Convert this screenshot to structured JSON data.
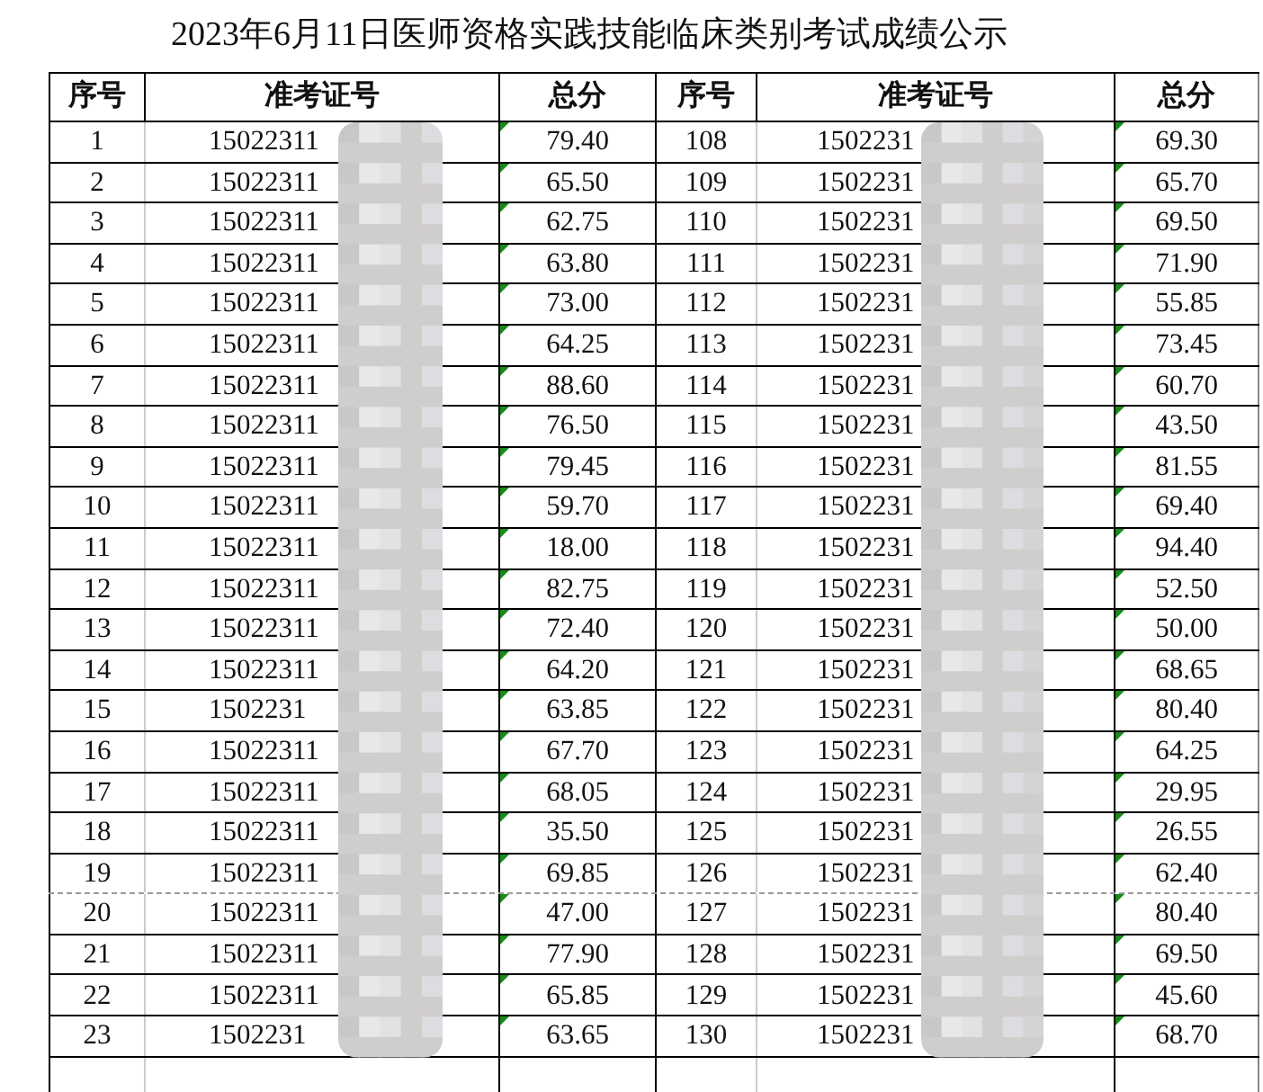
{
  "title": "2023年6月11日医师资格实践技能临床类别考试成绩公示",
  "columns": [
    "序号",
    "准考证号",
    "总分",
    "序号",
    "准考证号",
    "总分"
  ],
  "rows": [
    {
      "left": {
        "no": "1",
        "id": "15022311",
        "score": "79.40"
      },
      "right": {
        "no": "108",
        "id": "1502231",
        "score": "69.30"
      },
      "page_break": false
    },
    {
      "left": {
        "no": "2",
        "id": "15022311",
        "score": "65.50"
      },
      "right": {
        "no": "109",
        "id": "1502231",
        "score": "65.70"
      },
      "page_break": false
    },
    {
      "left": {
        "no": "3",
        "id": "15022311",
        "score": "62.75"
      },
      "right": {
        "no": "110",
        "id": "1502231",
        "score": "69.50"
      },
      "page_break": false
    },
    {
      "left": {
        "no": "4",
        "id": "15022311",
        "score": "63.80"
      },
      "right": {
        "no": "111",
        "id": "1502231",
        "score": "71.90"
      },
      "page_break": false
    },
    {
      "left": {
        "no": "5",
        "id": "15022311",
        "score": "73.00"
      },
      "right": {
        "no": "112",
        "id": "1502231",
        "score": "55.85"
      },
      "page_break": false
    },
    {
      "left": {
        "no": "6",
        "id": "15022311",
        "score": "64.25"
      },
      "right": {
        "no": "113",
        "id": "1502231",
        "score": "73.45"
      },
      "page_break": false
    },
    {
      "left": {
        "no": "7",
        "id": "15022311",
        "score": "88.60"
      },
      "right": {
        "no": "114",
        "id": "1502231",
        "score": "60.70"
      },
      "page_break": false
    },
    {
      "left": {
        "no": "8",
        "id": "15022311",
        "score": "76.50"
      },
      "right": {
        "no": "115",
        "id": "1502231",
        "score": "43.50"
      },
      "page_break": false
    },
    {
      "left": {
        "no": "9",
        "id": "15022311",
        "score": "79.45"
      },
      "right": {
        "no": "116",
        "id": "1502231",
        "score": "81.55"
      },
      "page_break": false
    },
    {
      "left": {
        "no": "10",
        "id": "15022311",
        "score": "59.70"
      },
      "right": {
        "no": "117",
        "id": "1502231",
        "score": "69.40"
      },
      "page_break": false
    },
    {
      "left": {
        "no": "11",
        "id": "15022311",
        "score": "18.00"
      },
      "right": {
        "no": "118",
        "id": "1502231",
        "score": "94.40"
      },
      "page_break": false
    },
    {
      "left": {
        "no": "12",
        "id": "15022311",
        "score": "82.75"
      },
      "right": {
        "no": "119",
        "id": "1502231",
        "score": "52.50"
      },
      "page_break": false
    },
    {
      "left": {
        "no": "13",
        "id": "15022311",
        "score": "72.40"
      },
      "right": {
        "no": "120",
        "id": "1502231",
        "score": "50.00"
      },
      "page_break": false
    },
    {
      "left": {
        "no": "14",
        "id": "15022311",
        "score": "64.20"
      },
      "right": {
        "no": "121",
        "id": "1502231",
        "score": "68.65"
      },
      "page_break": false
    },
    {
      "left": {
        "no": "15",
        "id": "1502231",
        "score": "63.85"
      },
      "right": {
        "no": "122",
        "id": "1502231",
        "score": "80.40"
      },
      "page_break": false
    },
    {
      "left": {
        "no": "16",
        "id": "15022311",
        "score": "67.70"
      },
      "right": {
        "no": "123",
        "id": "1502231",
        "score": "64.25"
      },
      "page_break": false
    },
    {
      "left": {
        "no": "17",
        "id": "15022311",
        "score": "68.05"
      },
      "right": {
        "no": "124",
        "id": "1502231",
        "score": "29.95"
      },
      "page_break": false
    },
    {
      "left": {
        "no": "18",
        "id": "15022311",
        "score": "35.50"
      },
      "right": {
        "no": "125",
        "id": "1502231",
        "score": "26.55"
      },
      "page_break": false
    },
    {
      "left": {
        "no": "19",
        "id": "15022311",
        "score": "69.85"
      },
      "right": {
        "no": "126",
        "id": "1502231",
        "score": "62.40"
      },
      "page_break": true
    },
    {
      "left": {
        "no": "20",
        "id": "15022311",
        "score": "47.00"
      },
      "right": {
        "no": "127",
        "id": "1502231",
        "score": "80.40"
      },
      "page_break": false
    },
    {
      "left": {
        "no": "21",
        "id": "15022311",
        "score": "77.90"
      },
      "right": {
        "no": "128",
        "id": "1502231",
        "score": "69.50"
      },
      "page_break": false
    },
    {
      "left": {
        "no": "22",
        "id": "15022311",
        "score": "65.85"
      },
      "right": {
        "no": "129",
        "id": "1502231",
        "score": "45.60"
      },
      "page_break": false
    },
    {
      "left": {
        "no": "23",
        "id": "1502231",
        "score": "63.65"
      },
      "right": {
        "no": "130",
        "id": "1502231",
        "score": "68.70"
      },
      "page_break": false
    }
  ]
}
